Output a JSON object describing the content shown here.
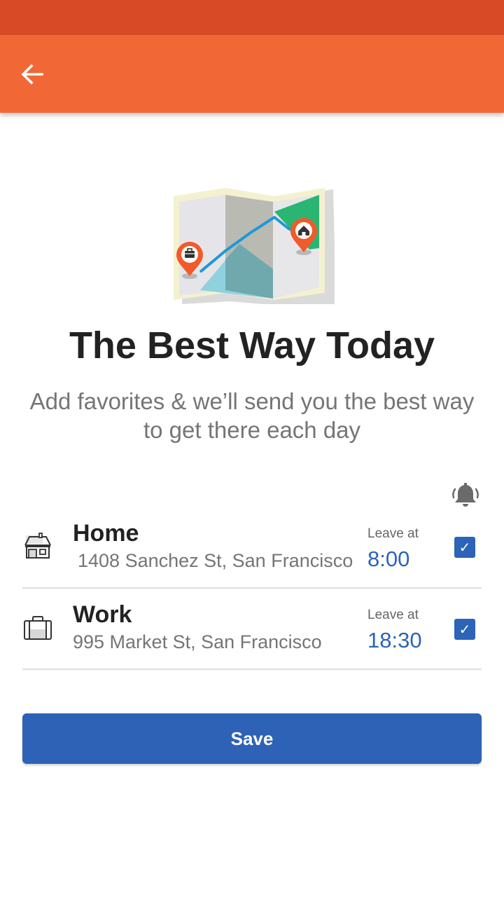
{
  "app_bar": {
    "back_icon": "arrow-back-icon",
    "status_bar_color": "#d84a26",
    "toolbar_color": "#f26736"
  },
  "hero": {
    "illustration_icon": "route-map-illustration",
    "title": "The Best Way Today",
    "subtitle": "Add favorites & we’ll send you the best way to get there each day"
  },
  "notifications": {
    "icon": "ringing-bell-icon"
  },
  "favorites": [
    {
      "icon": "house-icon",
      "name": "Home",
      "address": "1408 Sanchez St, San Francisco",
      "leave_label": "Leave at",
      "leave_time": "8:00",
      "checked": true
    },
    {
      "icon": "briefcase-icon",
      "name": "Work",
      "address": "995 Market St, San Francisco",
      "leave_label": "Leave at",
      "leave_time": "18:30",
      "checked": true
    }
  ],
  "save_button": {
    "label": "Save",
    "color": "#2e62b7"
  },
  "accent_color": "#2b64b8"
}
